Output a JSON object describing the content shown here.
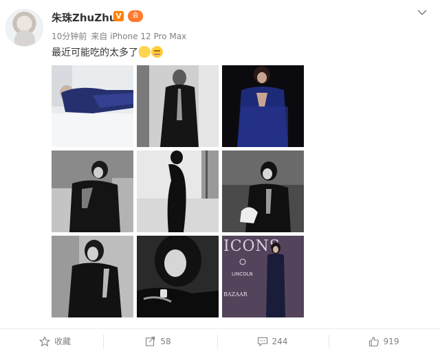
{
  "post": {
    "username": "朱珠ZhuZhu",
    "verified_badge": "V",
    "level_badge": "会",
    "time": "10分钟前",
    "source": "来自 iPhone 12 Pro Max",
    "text": "最近可能吃的太多了"
  },
  "photos": [
    {
      "alt": "photo-1",
      "tone": "color-lying-blue-sequin"
    },
    {
      "alt": "photo-2",
      "tone": "bw-black-dress-window"
    },
    {
      "alt": "photo-3",
      "tone": "color-blue-sequin-dark"
    },
    {
      "alt": "photo-4",
      "tone": "bw-seated-sofa"
    },
    {
      "alt": "photo-5",
      "tone": "bw-silhouette-window"
    },
    {
      "alt": "photo-6",
      "tone": "bw-seated-chair"
    },
    {
      "alt": "photo-7",
      "tone": "bw-profile-sequin"
    },
    {
      "alt": "photo-8",
      "tone": "bw-closeup-watch"
    },
    {
      "alt": "photo-9",
      "tone": "color-event-backdrop"
    }
  ],
  "backdrop_text": {
    "title": "ICONS",
    "brand": "LINCOLN",
    "mag": "BAZAAR"
  },
  "actions": {
    "favorite_label": "收藏",
    "repost_count": "58",
    "comment_count": "244",
    "like_count": "919"
  },
  "colors": {
    "accent": "#ff8200",
    "meta": "#808080",
    "text": "#333333"
  }
}
